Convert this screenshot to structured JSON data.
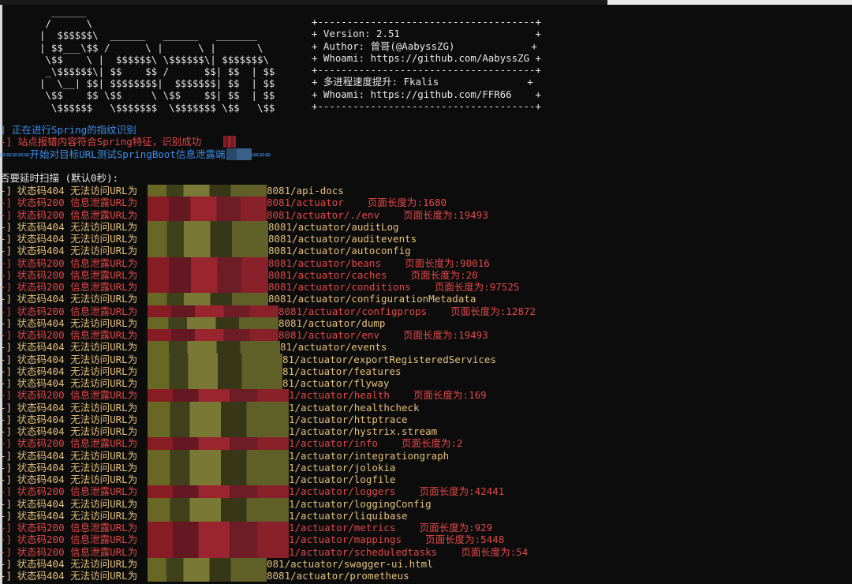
{
  "banner": {
    "ascii_art": "  ______\n /      \\\n|  $$$$$$\\  ______   ______   _______\n| $$___\\$$ /      \\ |      \\ |       \\\n \\$$    \\ |  $$$$$$\\ \\$$$$$$\\| $$$$$$$\\\n _\\$$$$$$\\| $$    $$ /      $$| $$  | $$\n|  \\__| $$| $$$$$$$$|  $$$$$$$| $$  | $$\n \\$$    $$ \\$$     \\ \\$$    $$| $$  | $$\n  \\$$$$$$   \\$$$$$$$  \\$$$$$$$ \\$$   \\$$",
    "info_box": "+-------------------------------------+\n+ Version: 2.51                       +\n+ Author: 曾哥(@AabyssZG)             +\n+ Whoami: https://github.com/AabyssZG +\n+-------------------------------------+\n+ 多进程速度提升: Fkalis               +\n+ Whoami: https://github.com/FFR66    +\n+-------------------------------------+"
  },
  "messages": {
    "fingerprint_prefix": "]",
    "fingerprint": " 正在进行Spring的指纹识别",
    "matched_prefix": "-]",
    "matched": " 站点报错内容符合Spring特征，识别成功",
    "start_scan": "=====开始对目标URL测试SpringBoot信息泄露端点======",
    "delay_prompt": "否要延时扫描 (默认0秒):"
  },
  "labels": {
    "code404": " 状态码404 无法访问URL为",
    "code200": " 状态码200 信息泄露URL为",
    "length_label": "页面长度为:"
  },
  "colors": {
    "blue": "#3b8eea",
    "red": "#e24848",
    "yellow": "#e5c07b",
    "white": "#e6e6e6",
    "background": "#0c0c0c"
  },
  "scan_rows": [
    {
      "status": "404",
      "path": "8081/api-docs",
      "length": ""
    },
    {
      "status": "200",
      "path": "8081/actuator",
      "length": "1680"
    },
    {
      "status": "200",
      "path": "8081/actuator/./env",
      "length": "19493"
    },
    {
      "status": "404",
      "path": "8081/actuator/auditLog",
      "length": ""
    },
    {
      "status": "404",
      "path": "8081/actuator/auditevents",
      "length": ""
    },
    {
      "status": "404",
      "path": "8081/actuator/autoconfig",
      "length": ""
    },
    {
      "status": "200",
      "path": "8081/actuator/beans",
      "length": "90016"
    },
    {
      "status": "200",
      "path": "8081/actuator/caches",
      "length": "20"
    },
    {
      "status": "200",
      "path": "8081/actuator/conditions",
      "length": "97525"
    },
    {
      "status": "404",
      "path": "8081/actuator/configurationMetadata",
      "length": ""
    },
    {
      "status": "200",
      "path": "8081/actuator/configprops",
      "length": "12872"
    },
    {
      "status": "404",
      "path": "8081/actuator/dump",
      "length": ""
    },
    {
      "status": "200",
      "path": "8081/actuator/env",
      "length": "19493"
    },
    {
      "status": "404",
      "path": "81/actuator/events",
      "length": ""
    },
    {
      "status": "404",
      "path": "81/actuator/exportRegisteredServices",
      "length": ""
    },
    {
      "status": "404",
      "path": "81/actuator/features",
      "length": ""
    },
    {
      "status": "404",
      "path": "81/actuator/flyway",
      "length": ""
    },
    {
      "status": "200",
      "path": "1/actuator/health",
      "length": "169"
    },
    {
      "status": "404",
      "path": "1/actuator/healthcheck",
      "length": ""
    },
    {
      "status": "404",
      "path": "1/actuator/httptrace",
      "length": ""
    },
    {
      "status": "404",
      "path": "1/actuator/hystrix.stream",
      "length": ""
    },
    {
      "status": "200",
      "path": "1/actuator/info",
      "length": "2"
    },
    {
      "status": "404",
      "path": "1/actuator/integrationgraph",
      "length": ""
    },
    {
      "status": "404",
      "path": "1/actuator/jolokia",
      "length": ""
    },
    {
      "status": "404",
      "path": "1/actuator/logfile",
      "length": ""
    },
    {
      "status": "200",
      "path": "1/actuator/loggers",
      "length": "42441"
    },
    {
      "status": "404",
      "path": "1/actuator/loggingConfig",
      "length": ""
    },
    {
      "status": "404",
      "path": "1/actuator/liquibase",
      "length": ""
    },
    {
      "status": "200",
      "path": "1/actuator/metrics",
      "length": "929"
    },
    {
      "status": "200",
      "path": "1/actuator/mappings",
      "length": "5448"
    },
    {
      "status": "200",
      "path": "1/actuator/scheduledtasks",
      "length": "54"
    },
    {
      "status": "404",
      "path": "081/actuator/swagger-ui.html",
      "length": ""
    },
    {
      "status": "404",
      "path": "8081/actuator/prometheus",
      "length": ""
    }
  ]
}
